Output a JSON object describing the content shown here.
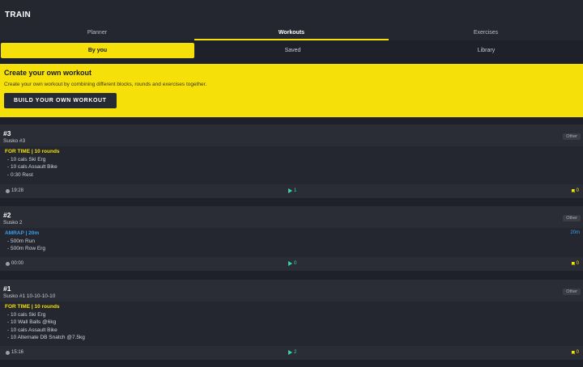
{
  "app": {
    "title": "TRAIN"
  },
  "tabs": [
    {
      "label": "Planner",
      "active": false
    },
    {
      "label": "Workouts",
      "active": true
    },
    {
      "label": "Exercises",
      "active": false
    }
  ],
  "subtabs": [
    {
      "label": "By you",
      "active": true
    },
    {
      "label": "Saved",
      "active": false
    },
    {
      "label": "Library",
      "active": false
    }
  ],
  "banner": {
    "title": "Create your own workout",
    "description": "Create your own workout by combining different blocks, rounds and exercises together.",
    "button_label": "BUILD YOUR OWN WORKOUT"
  },
  "workouts": [
    {
      "number": "#3",
      "name": "Susko #3",
      "tag": "Other",
      "format": "FOR TIME | 10 rounds",
      "format_color": "#f5e00a",
      "time_right": "",
      "lines": [
        "- 10 cals Ski Erg",
        "- 10 cals Assault Bike",
        "- 0:30 Rest"
      ],
      "duration": "19:28",
      "plays": "1",
      "saves": "0"
    },
    {
      "number": "#2",
      "name": "Susko 2",
      "tag": "Other",
      "format": "AMRAP | 20m",
      "format_color": "#3aa0f0",
      "time_right": "20m",
      "lines": [
        "- 500m Run",
        "- 500m Row Erg"
      ],
      "duration": "00:00",
      "plays": "0",
      "saves": "0"
    },
    {
      "number": "#1",
      "name": "Susko #1 10-10-10-10",
      "tag": "Other",
      "format": "FOR TIME | 10 rounds",
      "format_color": "#f5e00a",
      "time_right": "",
      "lines": [
        "- 10 cals Ski Erg",
        "- 10 Wall Balls @6kg",
        "- 10 cals Assault Bike",
        "- 10 Alternate DB Snatch @7.5kg"
      ],
      "duration": "15:16",
      "plays": "2",
      "saves": "0"
    }
  ]
}
